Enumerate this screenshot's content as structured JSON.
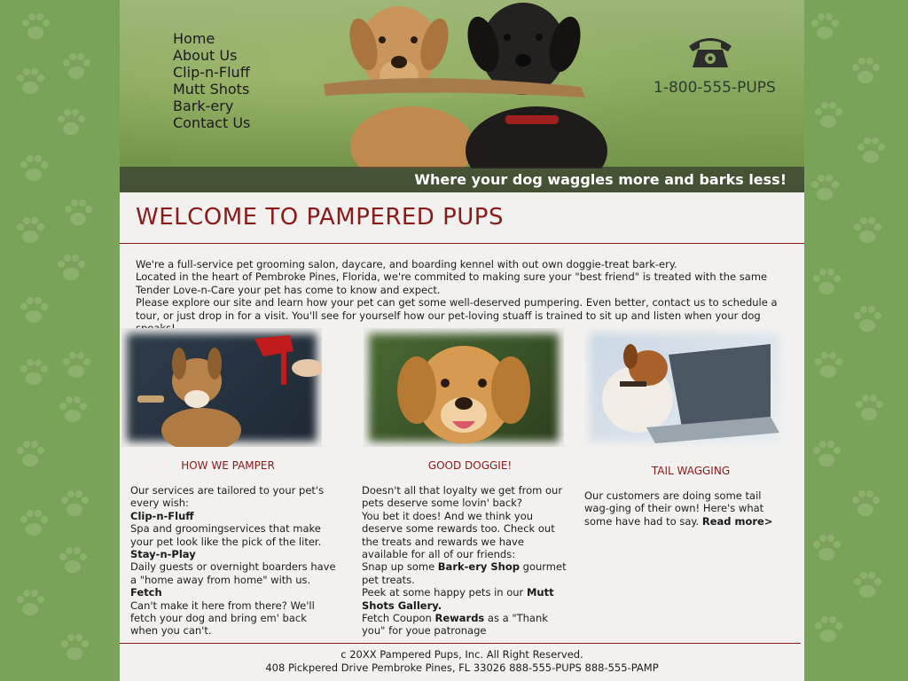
{
  "nav": {
    "items": [
      "Home",
      "About Us",
      "Clip-n-Fluff",
      "Mutt Shots",
      "Bark-ery",
      "Contact Us"
    ]
  },
  "header": {
    "phone_number": "1-800-555-PUPS",
    "tagline": "Where your dog waggles more and barks less!"
  },
  "main": {
    "title": "WELCOME TO PAMPERED PUPS",
    "intro": [
      "We're a full-service pet grooming salon, daycare, and boarding kennel with out own doggie-treat bark-ery.",
      "Located in the heart of Pembroke Pines, Florida, we're commited to making sure your \"best friend\" is treated with the same Tender Love-n-Care your pet has come to know and expect.",
      "Please explore our site and learn how your pet can get some well-deserved pumpering. Even better, contact us to schedule a tour, or just drop in for a visit. You'll see for yourself how our pet-loving stuaff is trained to sit up and listen when your dog speaks!"
    ]
  },
  "columns": {
    "pamper": {
      "heading": "HOW WE PAMPER",
      "intro": "Our services are tailored to your pet's every wish:",
      "items": [
        {
          "title": "Clip-n-Fluff",
          "text": "Spa and groomingservices that make your pet look like the pick of the liter."
        },
        {
          "title": "Stay-n-Play",
          "text": "Daily guests or overnight boarders have a \"home away from home\" with us."
        },
        {
          "title": "Fetch",
          "text": "Can't make it here from there? We'll fetch your dog and bring em' back when you can't."
        }
      ]
    },
    "doggie": {
      "heading": "GOOD DOGGIE!",
      "p1": "Doesn't all that loyalty we get from our pets deserve some lovin' back?",
      "p2": "You bet it does! And we think you deserve some rewards too. Check out the treats and rewards we have available for all of our friends:",
      "p3_pre": "Snap up some ",
      "p3_bold": "Bark-ery Shop",
      "p3_post": " gourmet pet treats.",
      "p4_pre": "Peek at some happy pets in our ",
      "p4_bold": "Mutt Shots Gallery.",
      "p5_pre": "Fetch Coupon ",
      "p5_bold": "Rewards",
      "p5_post": " as a \"Thank you\" for youe patronage"
    },
    "tail": {
      "heading": "TAIL WAGGING",
      "text": "Our customers are doing some tail wag-ging of their own! Here's what some have had to say. ",
      "link": "Read more>"
    }
  },
  "footer": {
    "line1": "c 20XX Pampered Pups, Inc. All Right Reserved.",
    "line2": "408 Pickpered Drive Pembroke Pines, FL 33026 888-555-PUPS  888-555-PAMP"
  },
  "icons": {
    "phone": "telephone-icon",
    "paw": "paw-print-icon"
  },
  "colors": {
    "background_green": "#7aa35a",
    "paw": "#9cbe7c",
    "accent_red": "#8b1a1a",
    "page_bg": "#f2f1ef"
  }
}
